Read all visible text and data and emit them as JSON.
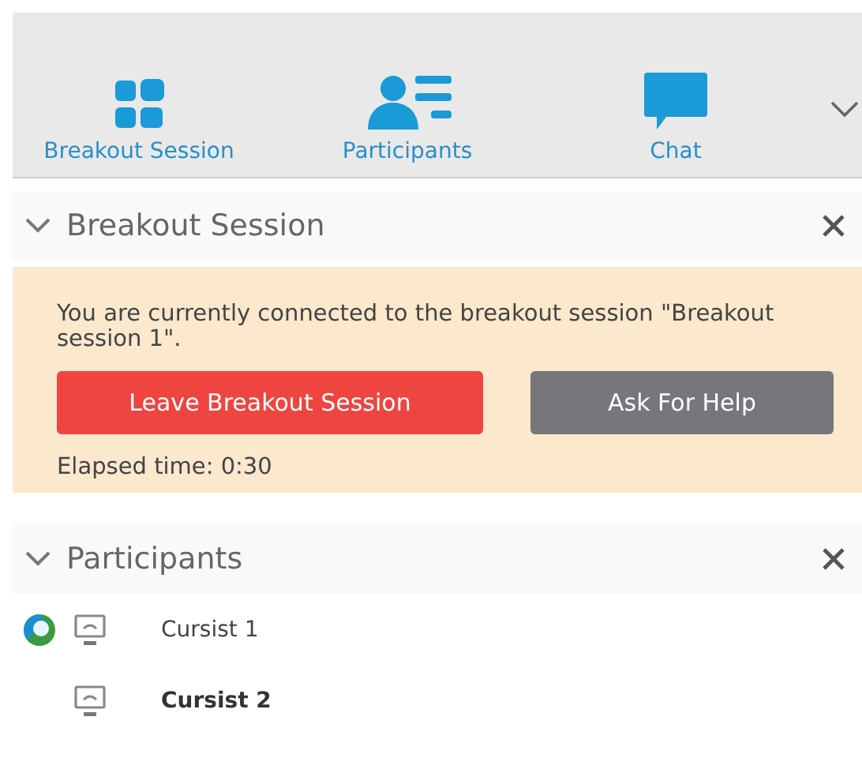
{
  "toolbar": {
    "tabs": [
      {
        "kind": "breakout",
        "label": "Breakout Session"
      },
      {
        "kind": "participants",
        "label": "Participants"
      },
      {
        "kind": "chat",
        "label": "Chat"
      }
    ]
  },
  "breakout_panel": {
    "title": "Breakout Session",
    "expanded": true,
    "message": "You are currently connected to the breakout session \"Breakout session 1\".",
    "buttons": [
      {
        "kind": "danger",
        "label": "Leave Breakout Session"
      },
      {
        "kind": "neutral",
        "label": "Ask For Help"
      }
    ],
    "elapsed": "Elapsed time: 0:30"
  },
  "participants_panel": {
    "title": "Participants",
    "expanded": true,
    "participants": [
      {
        "name": "Cursist 1",
        "host": true,
        "self": false
      },
      {
        "name": "Cursist 2",
        "host": false,
        "self": true
      }
    ]
  }
}
